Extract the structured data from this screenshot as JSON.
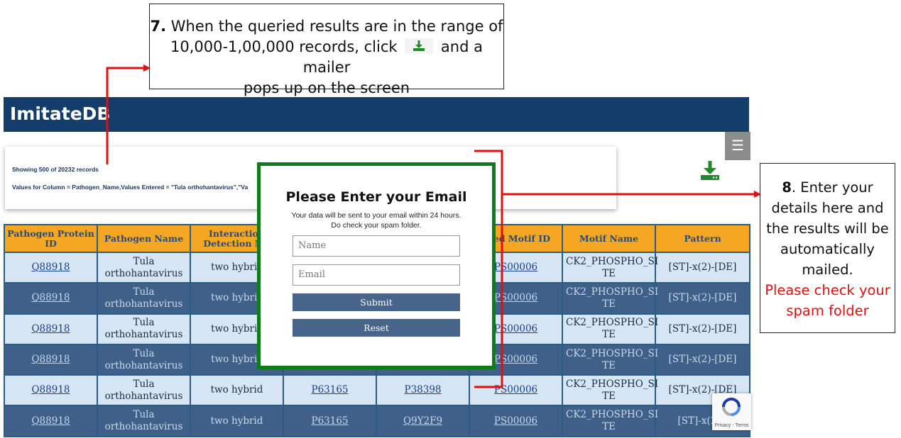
{
  "callout7": {
    "step": "7.",
    "line1_rest": " When the queried results are in the range of",
    "line2_before": "10,000-1,00,000 records, click",
    "line2_after": "and a mailer",
    "line3": "pops up on the screen"
  },
  "callout8": {
    "step": "8",
    "text": ". Enter your details here and the results will be automatically mailed.",
    "warning": "Please check your spam folder"
  },
  "app": {
    "title": "ImitateDB",
    "menu_glyph": "☰",
    "showing_text": "Showing 500 of 20232 records",
    "query_text": "Values for Column = Pathogen_Name,Values Entered = \"Tula orthohantavirus\",\"Va"
  },
  "table": {
    "headers": [
      "Pathogen Protein ID",
      "Pathogen Name",
      "Interaction Detection Me",
      "",
      "",
      "ched Motif ID",
      "Motif Name",
      "Pattern"
    ],
    "rows": [
      [
        "Q88918",
        "Tula orthohantavirus",
        "two hybric",
        "",
        "",
        "PS00006",
        "CK2_PHOSPHO_SI TE",
        "[ST]-x(2)-[DE]"
      ],
      [
        "Q88918",
        "Tula orthohantavirus",
        "two hybric",
        "",
        "",
        "PS00006",
        "CK2_PHOSPHO_SI TE",
        "[ST]-x(2)-[DE]"
      ],
      [
        "Q88918",
        "Tula orthohantavirus",
        "two hybric",
        "",
        "",
        "PS00006",
        "CK2_PHOSPHO_SI TE",
        "[ST]-x(2)-[DE]"
      ],
      [
        "Q88918",
        "Tula orthohantavirus",
        "two hybric",
        "",
        "",
        "PS00006",
        "CK2_PHOSPHO_SI TE",
        "[ST]-x(2)-[DE]"
      ],
      [
        "Q88918",
        "Tula orthohantavirus",
        "two hybrid",
        "P63165",
        "P38398",
        "PS00006",
        "CK2_PHOSPHO_SI TE",
        "[ST]-x(2)-[DE]"
      ],
      [
        "Q88918",
        "Tula orthohantavirus",
        "two hybrid",
        "P63165",
        "Q9Y2F9",
        "PS00006",
        "CK2_PHOSPHO_SI TE",
        "[ST]-x(2)-["
      ]
    ]
  },
  "modal": {
    "title": "Please Enter your Email",
    "subtitle_line1": "Your data will be sent to your email within 24 hours.",
    "subtitle_line2": "Do check your spam folder.",
    "name_placeholder": "Name",
    "email_placeholder": "Email",
    "submit_label": "Submit",
    "reset_label": "Reset"
  },
  "recaptcha": {
    "terms": "Privacy - Terms"
  },
  "colors": {
    "header_bg": "#153d6b",
    "table_header_bg": "#f5a623",
    "row_light": "#d7e6f5",
    "row_dark": "#3f6088",
    "modal_border": "#0e7d19",
    "download_icon": "#1e8a2a",
    "arrow": "#e01010"
  },
  "icons": {
    "download": "download-icon",
    "menu": "hamburger-menu-icon",
    "captcha": "recaptcha-icon"
  }
}
